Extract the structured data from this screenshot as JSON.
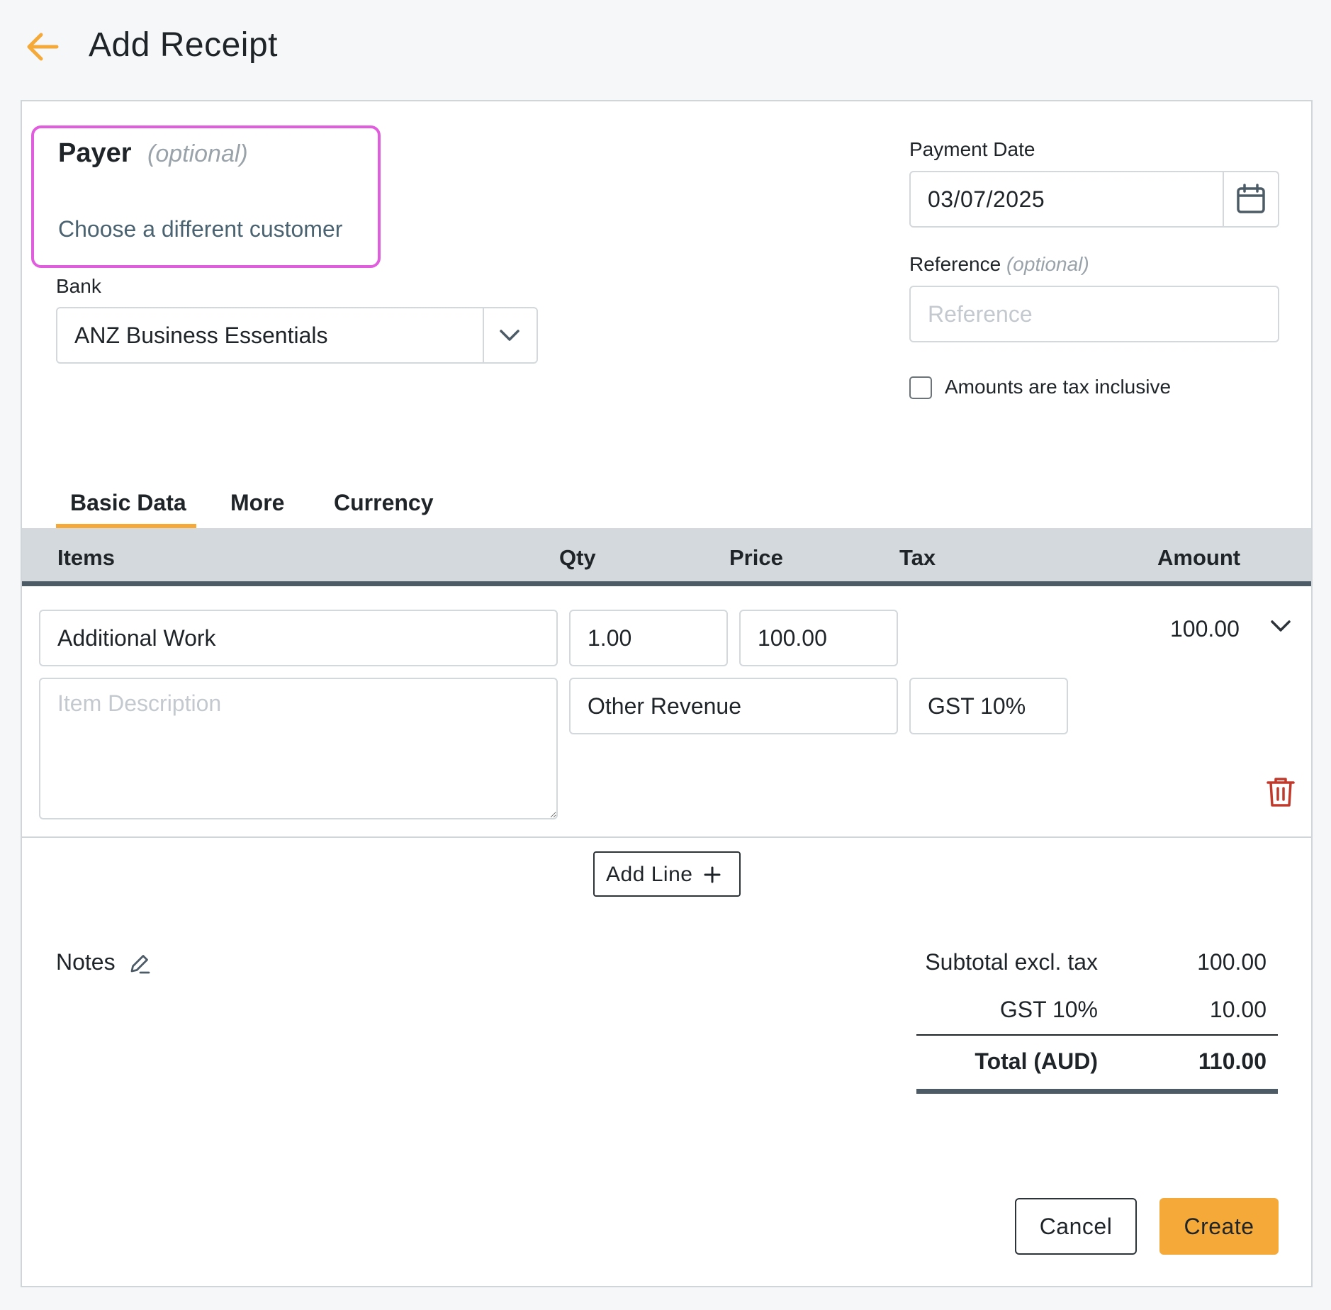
{
  "header": {
    "title": "Add Receipt",
    "back_icon": "arrow-left-icon",
    "accent_color": "#f4a938"
  },
  "payer": {
    "label": "Payer",
    "optional": "(optional)",
    "link": "Choose a different customer"
  },
  "bank": {
    "label": "Bank",
    "value": "ANZ Business Essentials"
  },
  "payment_date": {
    "label": "Payment Date",
    "value": "03/07/2025"
  },
  "reference": {
    "label": "Reference",
    "optional": "(optional)",
    "placeholder": "Reference",
    "value": ""
  },
  "tax_inclusive": {
    "label": "Amounts are tax inclusive",
    "checked": false
  },
  "tabs": [
    {
      "label": "Basic Data",
      "active": true
    },
    {
      "label": "More",
      "active": false
    },
    {
      "label": "Currency",
      "active": false
    }
  ],
  "table": {
    "columns": [
      "Items",
      "Qty",
      "Price",
      "Tax",
      "Amount"
    ],
    "rows": [
      {
        "item": "Additional Work",
        "qty": "1.00",
        "price": "100.00",
        "amount": "100.00",
        "description_placeholder": "Item Description",
        "account": "Other Revenue",
        "tax": "GST 10%"
      }
    ]
  },
  "add_line": {
    "label": "Add Line"
  },
  "notes": {
    "label": "Notes"
  },
  "totals": {
    "subtotal_label": "Subtotal excl. tax",
    "subtotal_value": "100.00",
    "tax_label": "GST 10%",
    "tax_value": "10.00",
    "total_label": "Total (AUD)",
    "total_value": "110.00"
  },
  "actions": {
    "cancel": "Cancel",
    "create": "Create"
  }
}
